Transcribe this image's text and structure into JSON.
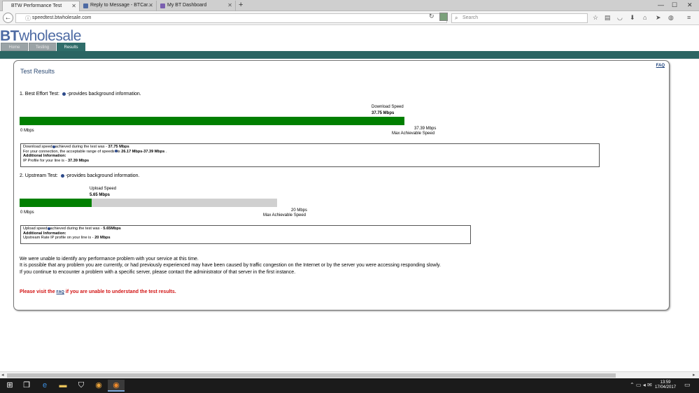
{
  "browser": {
    "tabs": [
      {
        "title": "BTW Performance Test",
        "active": true
      },
      {
        "title": "Reply to Message - BTCar...",
        "active": false
      },
      {
        "title": "My BT Dashboard",
        "active": false
      }
    ],
    "new_tab_label": "+",
    "url": "speedtest.btwholesale.com",
    "search_placeholder": "Search"
  },
  "site": {
    "logo_bt": "BT",
    "logo_wholesale": "wholesale",
    "nav_tabs": [
      "Home",
      "Testing",
      "Results"
    ],
    "active_nav": "Results"
  },
  "panel": {
    "title": "Test Results",
    "faq": "FAQ",
    "download_test": {
      "heading_prefix": "1. Best Effort Test:",
      "heading_suffix": "-provides background information.",
      "speed_label": "Download Speed",
      "speed_value": "37.75 Mbps",
      "min_label": "0 Mbps",
      "max_value": "37.39 Mbps",
      "max_label": "Max Achievable Speed",
      "fill_fraction": 1.0,
      "info": {
        "line1_prefix": "Download speed",
        "line1_mid": "achieved during the test was - ",
        "line1_value": "37.75 Mbps",
        "line2_prefix": "For your connection, the acceptable range of speeds",
        "line2_mid": "is ",
        "line2_value": "26.17 Mbps-37.39 Mbps",
        "line2_end": " .",
        "additional": "Additional Information:",
        "line4_prefix": "IP Profile for your line is - ",
        "line4_value": "37.39 Mbps"
      }
    },
    "upload_test": {
      "heading_prefix": "2. Upstream Test:",
      "heading_suffix": "-provides background information.",
      "speed_label": "Upload Speed",
      "speed_value": "5.65 Mbps",
      "min_label": "0 Mbps",
      "max_value": "20 Mbps",
      "max_label": "Max Achievable Speed",
      "fill_fraction": 0.28,
      "info": {
        "line1_prefix": "Upload speed",
        "line1_mid": "achieved during the test was - ",
        "line1_value": "5.65Mbps",
        "additional": "Additional Information:",
        "line3_prefix": "Upstream Rate IP profile on your line is - ",
        "line3_value": "20 Mbps"
      }
    },
    "message": [
      "We were unable to identify any performance problem with your service at this time.",
      "It is possible that any problem you are currently, or had previously experienced may have been caused by traffic congestion on the Internet or by the server you were accessing responding slowly.",
      "If you continue to encounter a problem with a specific server, please contact the administrator of that server in the first instance."
    ],
    "warning_prefix": "Please visit the ",
    "warning_link": "FAQ",
    "warning_suffix": " if you are unable to understand the test results."
  },
  "taskbar": {
    "time": "13:59",
    "date": "17/04/2017"
  },
  "colors": {
    "bt_blue": "#4d6aa3",
    "band_teal": "#2b6563",
    "bar_green": "#007f00",
    "warning_red": "#d21414"
  }
}
